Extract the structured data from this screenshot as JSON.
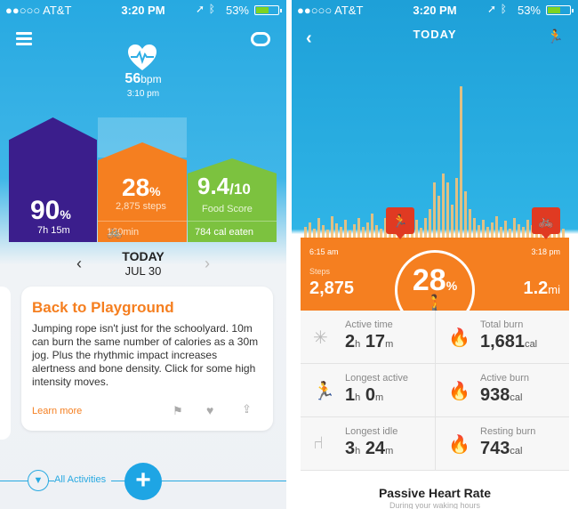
{
  "colors": {
    "accent_blue": "#27a9e1",
    "orange": "#f57f20",
    "purple": "#3b1e8c",
    "green": "#7cc23f",
    "pin_red": "#e03a22"
  },
  "left": {
    "status": {
      "carrier": "●●○○○ AT&T",
      "time": "3:20 PM",
      "battery": "53%"
    },
    "heart_rate": {
      "value": "56",
      "unit": "bpm",
      "time": "3:10 pm"
    },
    "sleep": {
      "percent": "90",
      "pct_sign": "%",
      "duration": "7h 15m"
    },
    "steps": {
      "percent": "28",
      "pct_sign": "%",
      "count": "2,875 steps",
      "workout": "120min"
    },
    "food": {
      "score": "9.4",
      "scale": "/10",
      "label": "Food Score",
      "calories": "784 cal eaten"
    },
    "date": {
      "label": "TODAY",
      "date": "JUL 30"
    },
    "card": {
      "title": "Back to Playground",
      "body": "Jumping rope isn't just for the schoolyard. 10m can burn the same number of calories as a 30m jog. Plus the rhythmic impact increases alertness and bone density. Click for some high intensity moves.",
      "link": "Learn more"
    },
    "bottom": {
      "filter_label": "All Activities",
      "add": "+"
    }
  },
  "right": {
    "status": {
      "carrier": "●●○○○ AT&T",
      "time": "3:20 PM",
      "battery": "53%"
    },
    "title": "TODAY",
    "start_time": "6:15 am",
    "end_time": "3:18 pm",
    "steps_label": "Steps",
    "steps_value": "2,875",
    "percent": "28",
    "pct_sign": "%",
    "distance": "1.2",
    "distance_unit": "mi",
    "stats": [
      {
        "label": "Active time",
        "v1": "2",
        "u1": "h",
        "v2": "17",
        "u2": "m"
      },
      {
        "label": "Total burn",
        "v1": "1,681",
        "u1": "cal",
        "v2": "",
        "u2": ""
      },
      {
        "label": "Longest active",
        "v1": "1",
        "u1": "h",
        "v2": "0",
        "u2": "m"
      },
      {
        "label": "Active burn",
        "v1": "938",
        "u1": "cal",
        "v2": "",
        "u2": ""
      },
      {
        "label": "Longest idle",
        "v1": "3",
        "u1": "h",
        "v2": "24",
        "u2": "m"
      },
      {
        "label": "Resting burn",
        "v1": "743",
        "u1": "cal",
        "v2": "",
        "u2": ""
      }
    ],
    "passive_title": "Passive Heart Rate",
    "passive_sub": "During your waking hours"
  }
}
